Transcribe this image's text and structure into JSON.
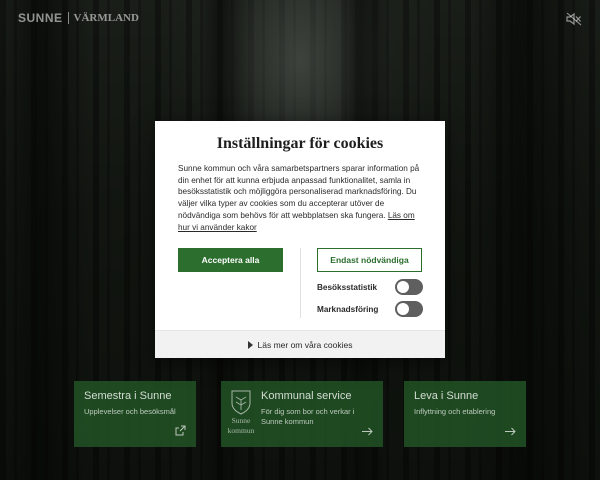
{
  "header": {
    "logo_left": "SUNNE",
    "logo_right": "VÄRMLAND",
    "mute_icon": "sound-muted-icon"
  },
  "cookie_dialog": {
    "title": "Inställningar för cookies",
    "body": "Sunne kommun och våra samarbetspartners sparar information på din enhet för att kunna erbjuda anpassad funktionalitet, samla in besöksstatistik och möjliggöra personaliserad marknadsföring. Du väljer vilka typer av cookies som du accepterar utöver de nödvändiga som behövs för att webbplatsen ska fungera.",
    "policy_link": "Läs om hur vi använder kakor",
    "accept_all_label": "Acceptera alla",
    "necessary_only_label": "Endast nödvändiga",
    "toggles": [
      {
        "label": "Besöksstatistik",
        "checked": false
      },
      {
        "label": "Marknadsföring",
        "checked": false
      }
    ],
    "read_more_label": "Läs mer om våra cookies",
    "accent_color": "#2b6e2e"
  },
  "cards": [
    {
      "title": "Semestra i Sunne",
      "subtitle": "Upplevelser och besöksmål",
      "icon": "external-link-icon"
    },
    {
      "title": "Kommunal service",
      "subtitle": "För dig som bor och verkar i Sunne kommun",
      "crest_line1": "Sunne",
      "crest_line2": "kommun",
      "icon": "arrow-right-icon"
    },
    {
      "title": "Leva i Sunne",
      "subtitle": "Inflyttning och etablering",
      "icon": "arrow-right-icon"
    }
  ]
}
